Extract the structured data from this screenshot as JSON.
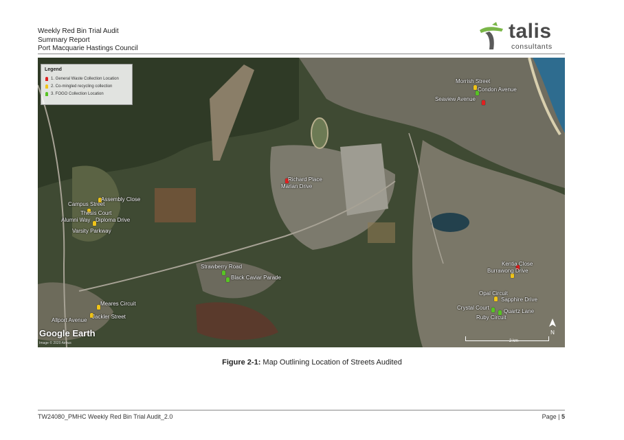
{
  "header": {
    "line1": "Weekly Red Bin Trial Audit",
    "line2": "Summary Report",
    "line3": "Port Macquarie Hastings Council"
  },
  "logo": {
    "word": "talis",
    "sub": "consultants",
    "brand_color": "#7ab648",
    "accent_color": "#5a5a5a"
  },
  "legend": {
    "title": "Legend",
    "items": [
      {
        "label": "1. General Waste Collection Location",
        "color": "#e02020"
      },
      {
        "label": "2. Co-mingled recycling collection",
        "color": "#f0c419"
      },
      {
        "label": "3. FOGO Collection Location",
        "color": "#58c324"
      }
    ]
  },
  "streets": [
    {
      "label": "Morrish Street",
      "color": "#f0c419"
    },
    {
      "label": "Condon Avenue",
      "color": "#58c324"
    },
    {
      "label": "Seaview Avenue",
      "color": "#e02020"
    },
    {
      "label": "Richard Place",
      "color": "#e02020"
    },
    {
      "label": "Marian Drive",
      "color": "#e02020"
    },
    {
      "label": "Assembly Close",
      "color": "#f0c419"
    },
    {
      "label": "Campus Street",
      "color": "#f0c419"
    },
    {
      "label": "Thesis Court",
      "color": "#f0c419"
    },
    {
      "label": "Alumni Way",
      "color": "#f0c419"
    },
    {
      "label": "Diploma Drive",
      "color": "#f0c419"
    },
    {
      "label": "Varsity Parkway",
      "color": "#f0c419"
    },
    {
      "label": "Strawberry Road",
      "color": "#58c324"
    },
    {
      "label": "Black Caviar Parade",
      "color": "#58c324"
    },
    {
      "label": "Kentia Close",
      "color": "#e02020"
    },
    {
      "label": "Burrawong Drive",
      "color": "#f0c419"
    },
    {
      "label": "Opal Circuit",
      "color": "#f0c419"
    },
    {
      "label": "Sapphire Drive",
      "color": "#f0c419"
    },
    {
      "label": "Crystal Court",
      "color": "#58c324"
    },
    {
      "label": "Quartz Lane",
      "color": "#58c324"
    },
    {
      "label": "Ruby Circuit",
      "color": "#58c324"
    },
    {
      "label": "Meares Circuit",
      "color": "#f0c419"
    },
    {
      "label": "Jackler Street",
      "color": "#f0c419"
    },
    {
      "label": "Allport Avenue",
      "color": "#f0c419"
    }
  ],
  "map_overlay": {
    "brand": "Google Earth",
    "credit": "Image © 2020 Airbus",
    "scale": "2 km",
    "north": "N"
  },
  "caption": {
    "label": "Figure 2-1:",
    "text": " Map Outlining Location of Streets Audited"
  },
  "footer": {
    "left": "TW24080_PMHC Weekly Red Bin Trial Audit_2.0",
    "page_prefix": "Page | ",
    "page_number": "5"
  }
}
